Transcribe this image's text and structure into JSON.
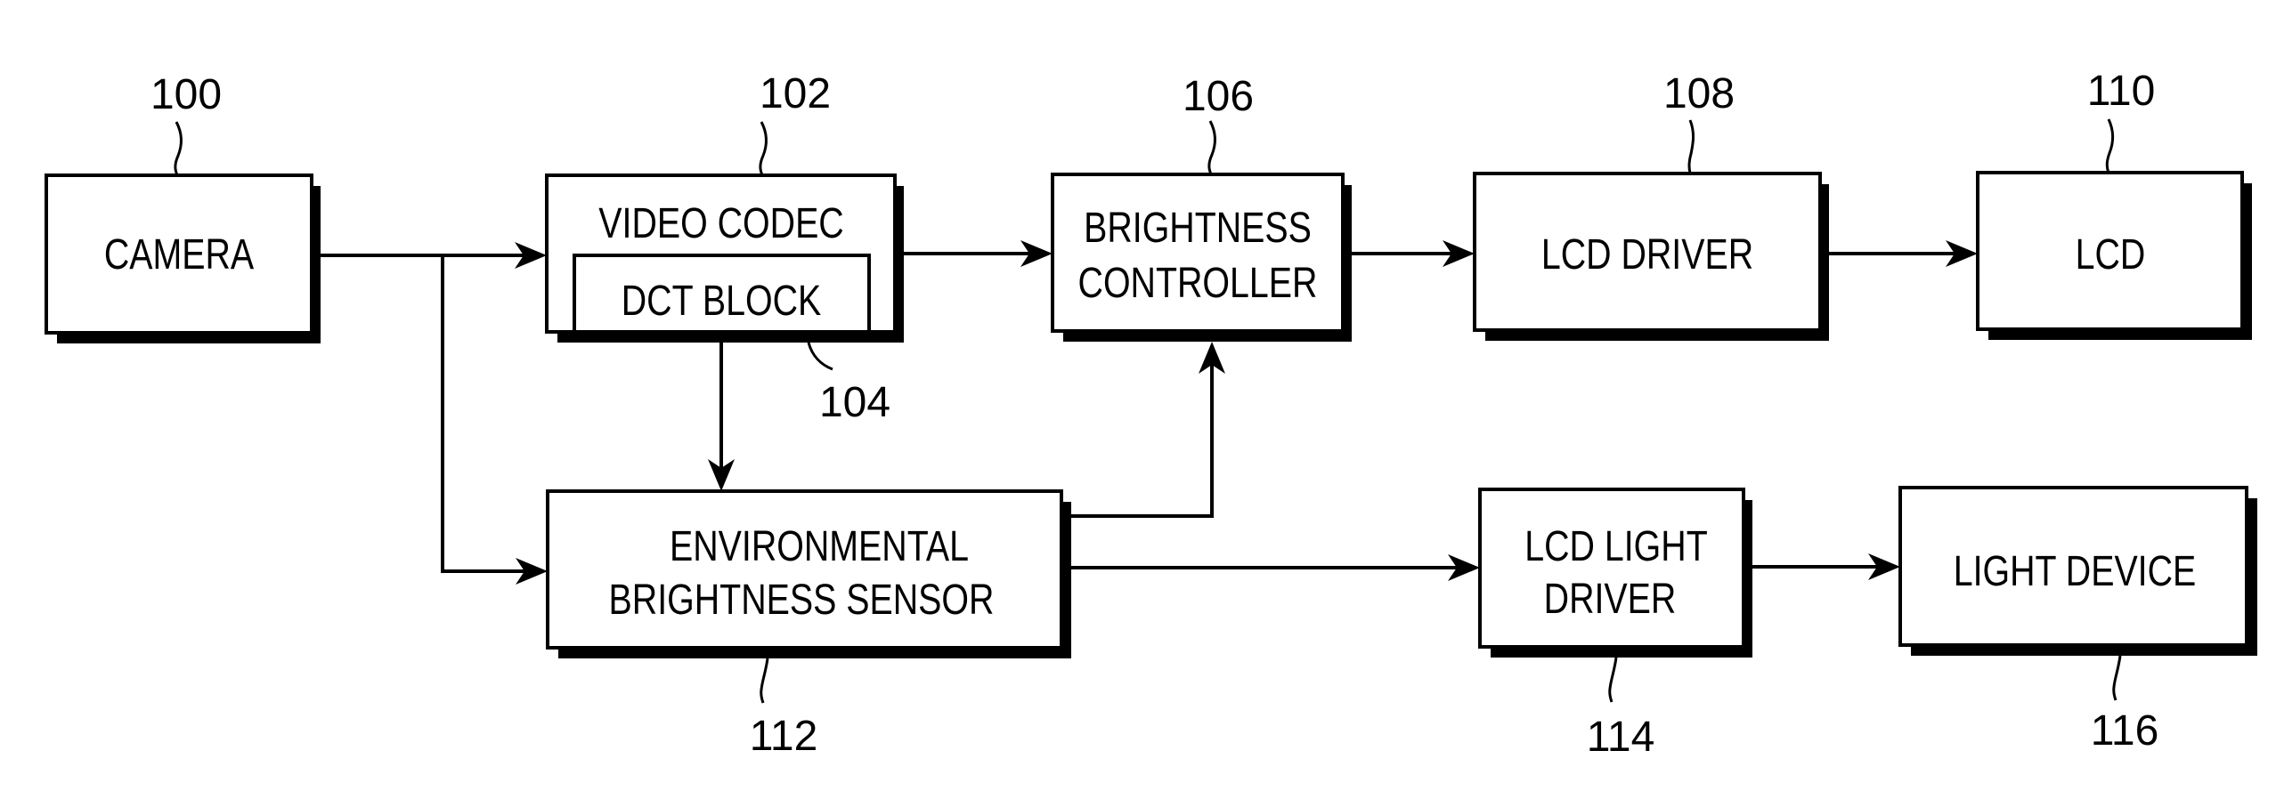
{
  "diagram": {
    "type": "block-diagram",
    "colors": {
      "line": "#000000",
      "background": "#ffffff"
    },
    "blocks": [
      {
        "id": "camera",
        "ref": "100",
        "lines": [
          "CAMERA"
        ]
      },
      {
        "id": "video-codec",
        "ref": "102",
        "lines": [
          "VIDEO CODEC"
        ]
      },
      {
        "id": "dct-block",
        "ref": "104",
        "lines": [
          "DCT BLOCK"
        ]
      },
      {
        "id": "brightness-controller",
        "ref": "106",
        "lines": [
          "BRIGHTNESS",
          "CONTROLLER"
        ]
      },
      {
        "id": "lcd-driver",
        "ref": "108",
        "lines": [
          "LCD DRIVER"
        ]
      },
      {
        "id": "lcd",
        "ref": "110",
        "lines": [
          "LCD"
        ]
      },
      {
        "id": "environmental-brightness-sensor",
        "ref": "112",
        "lines": [
          "ENVIRONMENTAL",
          "BRIGHTNESS SENSOR"
        ]
      },
      {
        "id": "lcd-light-driver",
        "ref": "114",
        "lines": [
          "LCD LIGHT",
          "DRIVER"
        ]
      },
      {
        "id": "light-device",
        "ref": "116",
        "lines": [
          "LIGHT DEVICE"
        ]
      }
    ],
    "connections": [
      {
        "from": "camera",
        "to": "video-codec"
      },
      {
        "from": "camera",
        "to": "environmental-brightness-sensor"
      },
      {
        "from": "video-codec",
        "to": "brightness-controller"
      },
      {
        "from": "dct-block",
        "to": "environmental-brightness-sensor"
      },
      {
        "from": "environmental-brightness-sensor",
        "to": "brightness-controller"
      },
      {
        "from": "brightness-controller",
        "to": "lcd-driver"
      },
      {
        "from": "lcd-driver",
        "to": "lcd"
      },
      {
        "from": "environmental-brightness-sensor",
        "to": "lcd-light-driver"
      },
      {
        "from": "lcd-light-driver",
        "to": "light-device"
      }
    ]
  }
}
